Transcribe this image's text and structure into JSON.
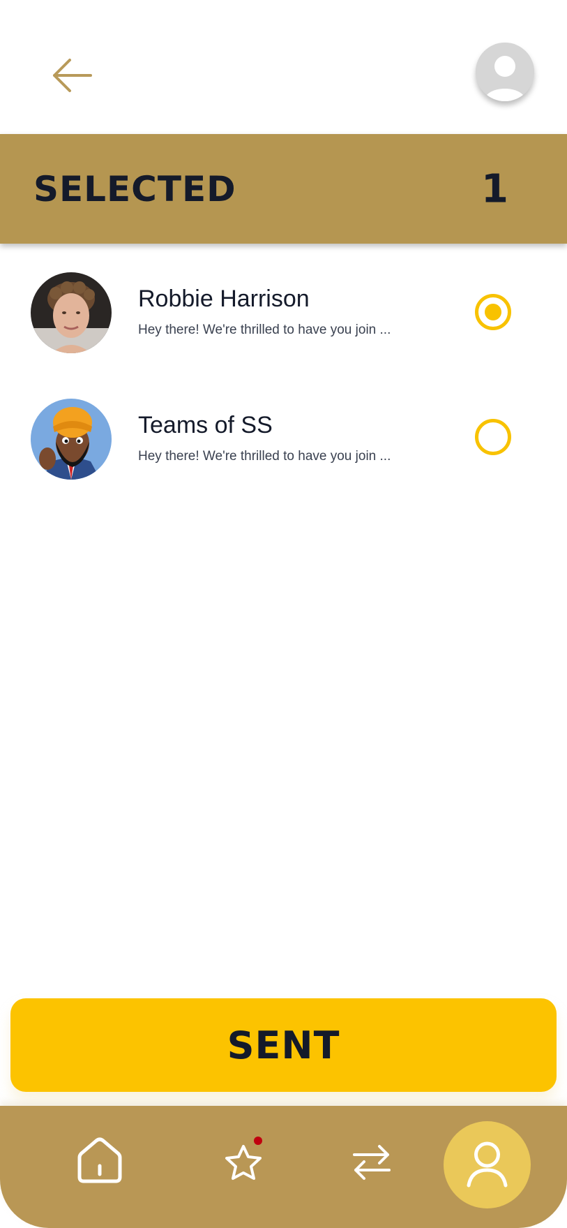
{
  "header": {
    "back_icon": "arrow-left-icon",
    "profile_icon": "user-avatar-placeholder"
  },
  "selected_bar": {
    "label": "SELECTED",
    "count": "1"
  },
  "contacts": [
    {
      "name": "Robbie Harrison",
      "message": "Hey there! We're thrilled to have you join ...",
      "selected": true
    },
    {
      "name": "Teams of SS",
      "message": "Hey there! We're thrilled to have you join ...",
      "selected": false
    }
  ],
  "sent_button": {
    "label": "SENT"
  },
  "bottom_nav": {
    "items": [
      {
        "icon": "home-icon"
      },
      {
        "icon": "star-icon",
        "badge": true
      },
      {
        "icon": "transfer-arrows-icon"
      },
      {
        "icon": "profile-icon",
        "active": true
      }
    ]
  },
  "colors": {
    "accent_gold": "#b59651",
    "nav_gold": "#b99755",
    "yellow": "#fcc300",
    "radio_yellow": "#f8c200",
    "text_dark": "#141a2a",
    "badge_red": "#c0000f",
    "back_arrow": "#b89a5a"
  }
}
